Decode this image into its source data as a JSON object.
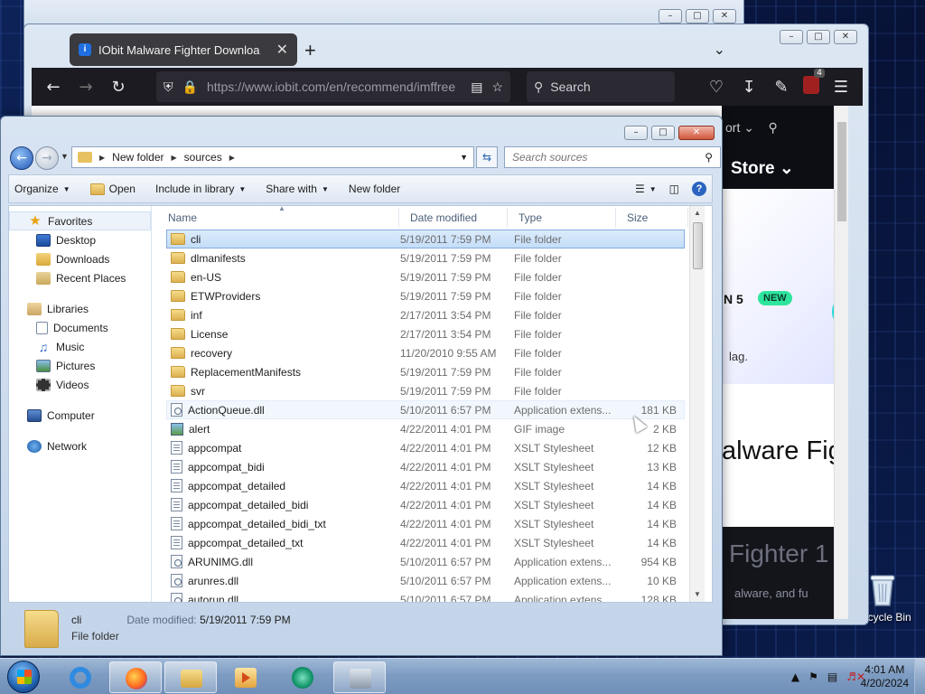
{
  "browser": {
    "tab_title": "IObit Malware Fighter Downloa",
    "new_tab_symbol": "+",
    "url": "https://www.iobit.com/en/recommend/imffree",
    "search_placeholder": "Search",
    "ublock_count": "4",
    "page": {
      "nav_support": "ort",
      "nav_store": "Store",
      "promo_version": "N 5",
      "promo_badge": "NEW",
      "promo_text": "lag.",
      "headline": "alware Figh",
      "footer_title": "Fighter 1",
      "footer_sub": "alware, and fu"
    }
  },
  "explorer": {
    "breadcrumb": [
      "New folder",
      "sources"
    ],
    "search_placeholder": "Search sources",
    "toolbar": {
      "organize": "Organize",
      "open": "Open",
      "include_in_library": "Include in library",
      "share_with": "Share with",
      "new_folder": "New folder"
    },
    "nav": {
      "favorites": "Favorites",
      "desktop": "Desktop",
      "downloads": "Downloads",
      "recent_places": "Recent Places",
      "libraries": "Libraries",
      "documents": "Documents",
      "music": "Music",
      "pictures": "Pictures",
      "videos": "Videos",
      "computer": "Computer",
      "network": "Network"
    },
    "columns": {
      "name": "Name",
      "date": "Date modified",
      "type": "Type",
      "size": "Size"
    },
    "files": [
      {
        "name": "cli",
        "date": "5/19/2011 7:59 PM",
        "type": "File folder",
        "size": "",
        "icon": "folder-icon"
      },
      {
        "name": "dlmanifests",
        "date": "5/19/2011 7:59 PM",
        "type": "File folder",
        "size": "",
        "icon": "folder-icon"
      },
      {
        "name": "en-US",
        "date": "5/19/2011 7:59 PM",
        "type": "File folder",
        "size": "",
        "icon": "folder-icon"
      },
      {
        "name": "ETWProviders",
        "date": "5/19/2011 7:59 PM",
        "type": "File folder",
        "size": "",
        "icon": "folder-icon"
      },
      {
        "name": "inf",
        "date": "2/17/2011 3:54 PM",
        "type": "File folder",
        "size": "",
        "icon": "folder-icon"
      },
      {
        "name": "License",
        "date": "2/17/2011 3:54 PM",
        "type": "File folder",
        "size": "",
        "icon": "folder-icon"
      },
      {
        "name": "recovery",
        "date": "11/20/2010 9:55 AM",
        "type": "File folder",
        "size": "",
        "icon": "folder-icon"
      },
      {
        "name": "ReplacementManifests",
        "date": "5/19/2011 7:59 PM",
        "type": "File folder",
        "size": "",
        "icon": "folder-icon"
      },
      {
        "name": "svr",
        "date": "5/19/2011 7:59 PM",
        "type": "File folder",
        "size": "",
        "icon": "folder-icon"
      },
      {
        "name": "ActionQueue.dll",
        "date": "5/10/2011 6:57 PM",
        "type": "Application extens...",
        "size": "181 KB",
        "icon": "dll-file-icon"
      },
      {
        "name": "alert",
        "date": "4/22/2011 4:01 PM",
        "type": "GIF image",
        "size": "2 KB",
        "icon": "gif-file-icon"
      },
      {
        "name": "appcompat",
        "date": "4/22/2011 4:01 PM",
        "type": "XSLT Stylesheet",
        "size": "12 KB",
        "icon": "xslt-file-icon"
      },
      {
        "name": "appcompat_bidi",
        "date": "4/22/2011 4:01 PM",
        "type": "XSLT Stylesheet",
        "size": "13 KB",
        "icon": "xslt-file-icon"
      },
      {
        "name": "appcompat_detailed",
        "date": "4/22/2011 4:01 PM",
        "type": "XSLT Stylesheet",
        "size": "14 KB",
        "icon": "xslt-file-icon"
      },
      {
        "name": "appcompat_detailed_bidi",
        "date": "4/22/2011 4:01 PM",
        "type": "XSLT Stylesheet",
        "size": "14 KB",
        "icon": "xslt-file-icon"
      },
      {
        "name": "appcompat_detailed_bidi_txt",
        "date": "4/22/2011 4:01 PM",
        "type": "XSLT Stylesheet",
        "size": "14 KB",
        "icon": "xslt-file-icon"
      },
      {
        "name": "appcompat_detailed_txt",
        "date": "4/22/2011 4:01 PM",
        "type": "XSLT Stylesheet",
        "size": "14 KB",
        "icon": "xslt-file-icon"
      },
      {
        "name": "ARUNIMG.dll",
        "date": "5/10/2011 6:57 PM",
        "type": "Application extens...",
        "size": "954 KB",
        "icon": "dll-file-icon"
      },
      {
        "name": "arunres.dll",
        "date": "5/10/2011 6:57 PM",
        "type": "Application extens...",
        "size": "10 KB",
        "icon": "dll-file-icon"
      },
      {
        "name": "autorun.dll",
        "date": "5/10/2011 6:57 PM",
        "type": "Application extens...",
        "size": "128 KB",
        "icon": "dll-file-icon"
      }
    ],
    "selected_index": 0,
    "hover_index": 9,
    "details": {
      "name": "cli",
      "date_label": "Date modified:",
      "date_value": "5/19/2011 7:59 PM",
      "type": "File folder"
    }
  },
  "desktop": {
    "recycle_bin_label": "Recycle Bin"
  },
  "taskbar": {
    "time": "4:01 AM",
    "date": "4/20/2024"
  },
  "colors": {
    "selection": "#cce4f7",
    "taskbar": "#7e9cc2",
    "browser_toolbar": "#1c1b22"
  }
}
